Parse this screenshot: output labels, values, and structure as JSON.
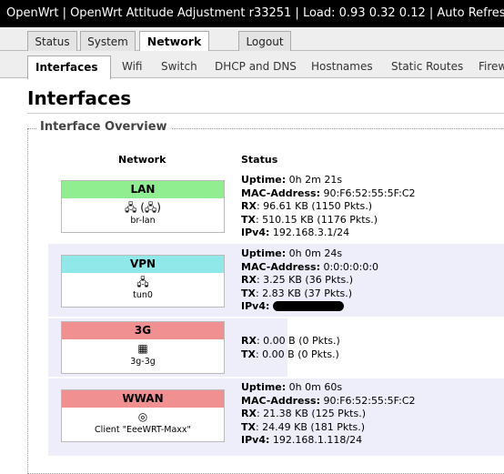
{
  "header": {
    "title_text": "OpenWrt | OpenWrt Attitude Adjustment r33251 | Load: 0.93 0.32 0.12 | Auto Refresh: ",
    "auto_refresh_state": "on"
  },
  "main_tabs": [
    {
      "label": "Status"
    },
    {
      "label": "System"
    },
    {
      "label": "Network"
    },
    {
      "label": "Logout"
    }
  ],
  "sub_tabs": [
    {
      "label": "Interfaces"
    },
    {
      "label": "Wifi"
    },
    {
      "label": "Switch"
    },
    {
      "label": "DHCP and DNS"
    },
    {
      "label": "Hostnames"
    },
    {
      "label": "Static Routes"
    },
    {
      "label": "Firew"
    }
  ],
  "page": {
    "title": "Interfaces",
    "section_legend": "Interface Overview",
    "col_network": "Network",
    "col_status": "Status"
  },
  "labels": {
    "uptime": "Uptime:",
    "mac": "MAC-Address:",
    "rx": "RX",
    "tx": "TX",
    "ipv4": "IPv4:"
  },
  "interfaces": [
    {
      "name": "LAN",
      "color": "#90ee90",
      "device": "br-lan",
      "uptime": "0h 2m 21s",
      "mac": "90:F6:52:55:5F:C2",
      "rx": ": 96.61 KB (1150 Pkts.)",
      "tx": ": 510.15 KB (1176 Pkts.)",
      "ipv4": "192.168.3.1/24"
    },
    {
      "name": "VPN",
      "color": "#90e8e8",
      "device": "tun0",
      "uptime": "0h 0m 24s",
      "mac": "0:0:0:0:0:0",
      "rx": ": 3.25 KB (36 Pkts.)",
      "tx": ": 2.83 KB (37 Pkts.)",
      "ipv4": ""
    },
    {
      "name": "3G",
      "color": "#f09090",
      "device": "3g-3g",
      "rx": ": 0.00 B (0 Pkts.)",
      "tx": ": 0.00 B (0 Pkts.)"
    },
    {
      "name": "WWAN",
      "color": "#f09090",
      "device": "Client \"EeeWRT-Maxx\"",
      "uptime": "0h 0m 60s",
      "mac": "90:F6:52:55:5F:C2",
      "rx": ": 21.38 KB (125 Pkts.)",
      "tx": ": 24.49 KB (181 Pkts.)",
      "ipv4": "192.168.1.118/24"
    }
  ]
}
